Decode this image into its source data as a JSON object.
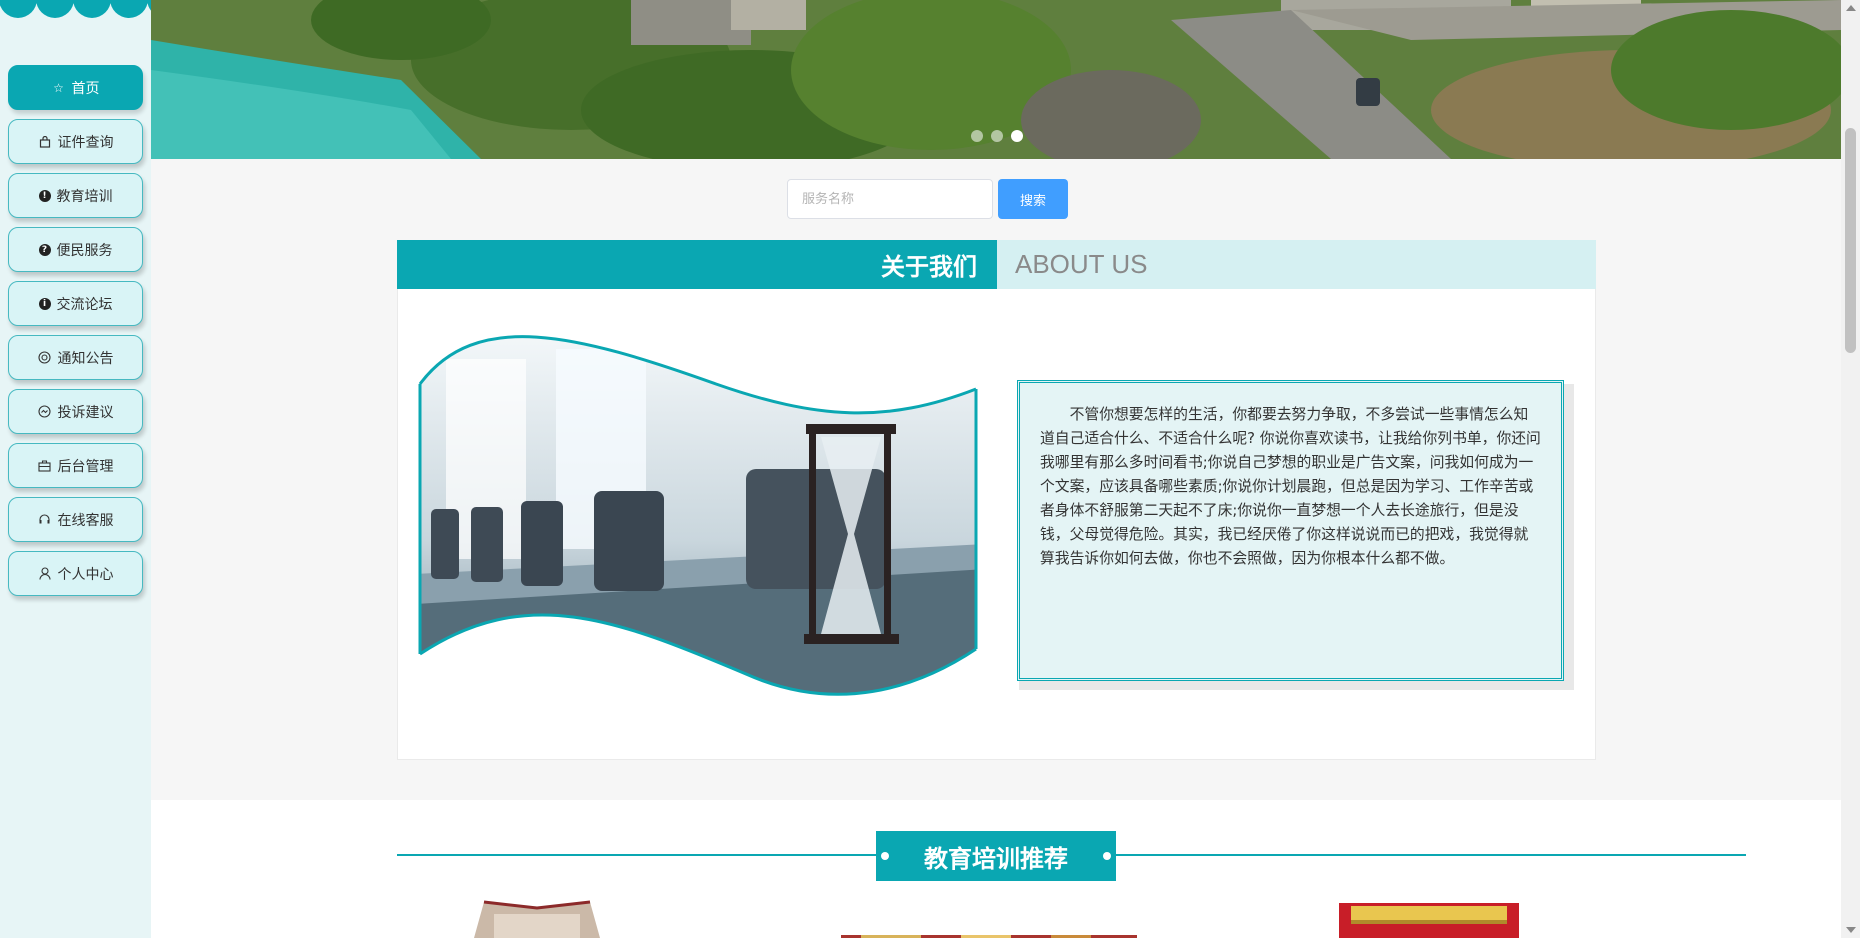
{
  "sidebar": {
    "items": [
      {
        "label": "首页",
        "icon": "star-icon",
        "active": true
      },
      {
        "label": "证件查询",
        "icon": "bag-icon",
        "active": false
      },
      {
        "label": "教育培训",
        "icon": "exclamation-icon",
        "active": false
      },
      {
        "label": "便民服务",
        "icon": "question-icon",
        "active": false
      },
      {
        "label": "交流论坛",
        "icon": "info-icon",
        "active": false
      },
      {
        "label": "通知公告",
        "icon": "headset-icon",
        "active": false
      },
      {
        "label": "投诉建议",
        "icon": "clock-icon",
        "active": false
      },
      {
        "label": "后台管理",
        "icon": "briefcase-icon",
        "active": false
      },
      {
        "label": "在线客服",
        "icon": "service-icon",
        "active": false
      },
      {
        "label": "个人中心",
        "icon": "user-icon",
        "active": false
      }
    ]
  },
  "banner": {
    "slide_count": 3,
    "active_slide": 3
  },
  "search": {
    "placeholder": "服务名称",
    "value": "",
    "button_label": "搜索"
  },
  "about": {
    "title": "关于我们",
    "subtitle": "ABOUT US",
    "text": "不管你想要怎样的生活，你都要去努力争取，不多尝试一些事情怎么知道自己适合什么、不适合什么呢? 你说你喜欢读书，让我给你列书单，你还问我哪里有那么多时间看书;你说自己梦想的职业是广告文案，问我如何成为一个文案，应该具备哪些素质;你说你计划晨跑，但总是因为学习、工作辛苦或者身体不舒服第二天起不了床;你说你一直梦想一个人去长途旅行，但是没钱，父母觉得危险。其实，我已经厌倦了你这样说说而已的把戏，我觉得就算我告诉你如何去做，你也不会照做，因为你根本什么都不做。"
  },
  "recommend": {
    "title": "教育培训推荐"
  },
  "colors": {
    "accent": "#0aa7b2",
    "accent_light": "#d5f0f2",
    "search_button": "#409eff"
  }
}
